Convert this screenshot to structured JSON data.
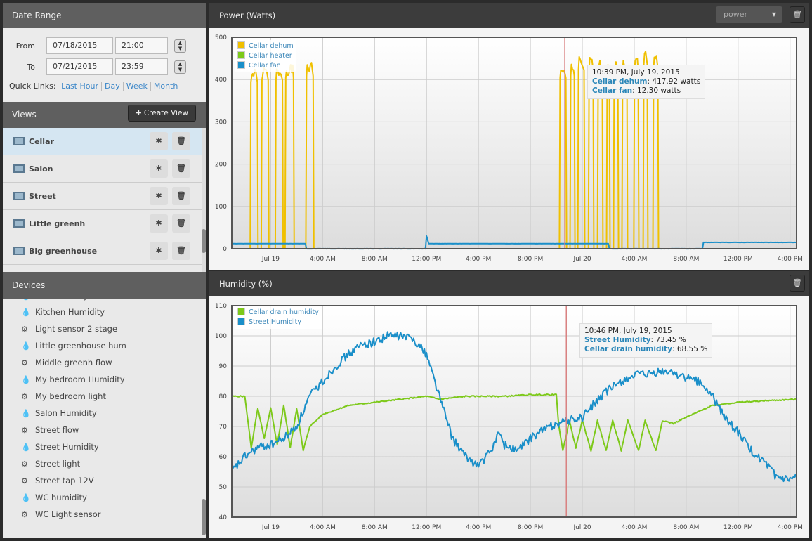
{
  "sidebar": {
    "date_range": {
      "title": "Date Range",
      "from_label": "From",
      "to_label": "To",
      "from_date": "07/18/2015",
      "from_time": "21:00",
      "to_date": "07/21/2015",
      "to_time": "23:59",
      "quick_links_label": "Quick Links:",
      "quick_links": [
        "Last Hour",
        "Day",
        "Week",
        "Month"
      ]
    },
    "views": {
      "title": "Views",
      "create_label": "Create View",
      "items": [
        {
          "label": "Cellar",
          "selected": true
        },
        {
          "label": "Salon"
        },
        {
          "label": "Street"
        },
        {
          "label": "Little greenh"
        },
        {
          "label": "Big greenhouse"
        }
      ]
    },
    "devices": {
      "title": "Devices",
      "partial_item": "WC Humidity",
      "items": [
        {
          "label": "Kitchen Humidity",
          "icon": "drop-icon"
        },
        {
          "label": "Light sensor 2 stage",
          "icon": "gear-icon"
        },
        {
          "label": "Little greenhouse hum",
          "icon": "drop-icon"
        },
        {
          "label": "Middle greenh flow",
          "icon": "gear-icon"
        },
        {
          "label": "My bedroom Humidity",
          "icon": "drop-icon"
        },
        {
          "label": "My bedroom light",
          "icon": "gear-icon"
        },
        {
          "label": "Salon Humidity",
          "icon": "drop-icon"
        },
        {
          "label": "Street flow",
          "icon": "gear-icon"
        },
        {
          "label": "Street Humidity",
          "icon": "drop-icon"
        },
        {
          "label": "Street light",
          "icon": "gear-icon"
        },
        {
          "label": "Street tap 12V",
          "icon": "gear-icon"
        },
        {
          "label": "WC humidity",
          "icon": "drop-icon"
        },
        {
          "label": "WC Light sensor",
          "icon": "gear-icon"
        }
      ]
    }
  },
  "panels": {
    "power": {
      "title": "Power (Watts)",
      "select_value": "power",
      "tooltip": {
        "time": "10:39 PM, July 19, 2015",
        "lines": [
          {
            "name": "Cellar dehum",
            "value": ": 417.92 watts"
          },
          {
            "name": "Cellar fan",
            "value": ": 12.30 watts"
          }
        ]
      }
    },
    "humidity": {
      "title": "Humidity (%)",
      "tooltip": {
        "time": "10:46 PM, July 19, 2015",
        "lines": [
          {
            "name": "Street Humidity",
            "value": ": 73.45 %"
          },
          {
            "name": "Cellar drain humidity",
            "value": ": 68.55 %"
          }
        ]
      }
    }
  },
  "chart_data": [
    {
      "type": "line",
      "xlim": [
        "2015-07-18T21:00",
        "2015-07-20T16:30"
      ],
      "ylim": [
        0,
        500
      ],
      "yticks": [
        0,
        100,
        200,
        300,
        400,
        500
      ],
      "xticks": [
        [
          "2015-07-19T00:00",
          "Jul 19"
        ],
        [
          "2015-07-19T04:00",
          "4:00 AM"
        ],
        [
          "2015-07-19T08:00",
          "8:00 AM"
        ],
        [
          "2015-07-19T12:00",
          "12:00 PM"
        ],
        [
          "2015-07-19T16:00",
          "4:00 PM"
        ],
        [
          "2015-07-19T20:00",
          "8:00 PM"
        ],
        [
          "2015-07-20T00:00",
          "Jul 20"
        ],
        [
          "2015-07-20T04:00",
          "4:00 AM"
        ],
        [
          "2015-07-20T08:00",
          "8:00 AM"
        ],
        [
          "2015-07-20T12:00",
          "12:00 PM"
        ],
        [
          "2015-07-20T16:00",
          "4:00 PM"
        ]
      ],
      "cursor": "2015-07-19T22:39",
      "legend": "top-left",
      "series": [
        {
          "name": "Cellar dehum",
          "color": "#f0c000",
          "on_intervals": [
            [
              "2015-07-18T22:25",
              "2015-07-18T22:58",
              415
            ],
            [
              "2015-07-18T23:16",
              "2015-07-18T23:48",
              420
            ],
            [
              "2015-07-19T00:21",
              "2015-07-19T00:54",
              420
            ],
            [
              "2015-07-19T01:06",
              "2015-07-19T01:45",
              425
            ],
            [
              "2015-07-19T02:42",
              "2015-07-19T03:16",
              430
            ],
            [
              "2015-07-19T22:14",
              "2015-07-19T22:44",
              425
            ],
            [
              "2015-07-19T23:03",
              "2015-07-19T23:23",
              430
            ],
            [
              "2015-07-19T23:39",
              "2015-07-20T00:08",
              445
            ],
            [
              "2015-07-20T00:28",
              "2015-07-20T00:50",
              445
            ],
            [
              "2015-07-20T01:10",
              "2015-07-20T01:32",
              440
            ],
            [
              "2015-07-20T01:52",
              "2015-07-20T02:05",
              440
            ],
            [
              "2015-07-20T02:24",
              "2015-07-20T02:44",
              435
            ],
            [
              "2015-07-20T03:03",
              "2015-07-20T03:26",
              440
            ],
            [
              "2015-07-20T03:58",
              "2015-07-20T04:18",
              445
            ],
            [
              "2015-07-20T04:41",
              "2015-07-20T05:00",
              460
            ],
            [
              "2015-07-20T05:26",
              "2015-07-20T05:49",
              450
            ]
          ]
        },
        {
          "name": "Cellar heater",
          "color": "#7dc91a",
          "on_intervals": []
        },
        {
          "name": "Cellar fan",
          "color": "#1a8fc9",
          "points": [
            [
              "2015-07-18T21:00",
              12
            ],
            [
              "2015-07-19T02:40",
              12
            ],
            [
              "2015-07-19T02:45",
              0
            ],
            [
              "2015-07-19T11:55",
              0
            ],
            [
              "2015-07-19T12:00",
              30
            ],
            [
              "2015-07-19T12:10",
              12
            ],
            [
              "2015-07-20T02:00",
              12
            ],
            [
              "2015-07-20T02:05",
              0
            ],
            [
              "2015-07-20T09:15",
              0
            ],
            [
              "2015-07-20T09:20",
              15
            ],
            [
              "2015-07-20T16:30",
              15
            ]
          ]
        }
      ]
    },
    {
      "type": "line",
      "xlim": [
        "2015-07-18T21:00",
        "2015-07-20T16:30"
      ],
      "ylim": [
        40,
        110
      ],
      "yticks": [
        40,
        50,
        60,
        70,
        80,
        90,
        100,
        110
      ],
      "xticks": [
        [
          "2015-07-19T00:00",
          "Jul 19"
        ],
        [
          "2015-07-19T04:00",
          "4:00 AM"
        ],
        [
          "2015-07-19T08:00",
          "8:00 AM"
        ],
        [
          "2015-07-19T12:00",
          "12:00 PM"
        ],
        [
          "2015-07-19T16:00",
          "4:00 PM"
        ],
        [
          "2015-07-19T20:00",
          "8:00 PM"
        ],
        [
          "2015-07-20T00:00",
          "Jul 20"
        ],
        [
          "2015-07-20T04:00",
          "4:00 AM"
        ],
        [
          "2015-07-20T08:00",
          "8:00 AM"
        ],
        [
          "2015-07-20T12:00",
          "12:00 PM"
        ],
        [
          "2015-07-20T16:00",
          "4:00 PM"
        ]
      ],
      "cursor": "2015-07-19T22:46",
      "legend": "top-left",
      "series": [
        {
          "name": "Cellar drain humidity",
          "color": "#7dc91a",
          "points": [
            [
              "2015-07-18T21:00",
              80
            ],
            [
              "2015-07-18T22:00",
              80
            ],
            [
              "2015-07-18T22:30",
              63
            ],
            [
              "2015-07-18T23:00",
              76
            ],
            [
              "2015-07-18T23:30",
              66
            ],
            [
              "2015-07-19T00:00",
              76
            ],
            [
              "2015-07-19T00:30",
              64
            ],
            [
              "2015-07-19T01:00",
              77
            ],
            [
              "2015-07-19T01:30",
              63
            ],
            [
              "2015-07-19T02:00",
              76
            ],
            [
              "2015-07-19T02:30",
              62
            ],
            [
              "2015-07-19T03:00",
              70
            ],
            [
              "2015-07-19T04:00",
              74
            ],
            [
              "2015-07-19T06:00",
              77
            ],
            [
              "2015-07-19T08:00",
              78
            ],
            [
              "2015-07-19T10:00",
              79
            ],
            [
              "2015-07-19T12:00",
              80
            ],
            [
              "2015-07-19T13:00",
              79
            ],
            [
              "2015-07-19T15:00",
              80
            ],
            [
              "2015-07-19T18:00",
              80
            ],
            [
              "2015-07-19T20:00",
              80.5
            ],
            [
              "2015-07-19T22:00",
              80.5
            ],
            [
              "2015-07-19T22:10",
              71
            ],
            [
              "2015-07-19T22:30",
              62
            ],
            [
              "2015-07-19T23:00",
              72
            ],
            [
              "2015-07-19T23:30",
              63
            ],
            [
              "2015-07-20T00:00",
              72
            ],
            [
              "2015-07-20T00:40",
              62
            ],
            [
              "2015-07-20T01:10",
              72
            ],
            [
              "2015-07-20T01:50",
              62
            ],
            [
              "2015-07-20T02:20",
              72
            ],
            [
              "2015-07-20T03:00",
              62
            ],
            [
              "2015-07-20T03:30",
              72
            ],
            [
              "2015-07-20T04:20",
              62
            ],
            [
              "2015-07-20T04:50",
              72
            ],
            [
              "2015-07-20T05:40",
              62
            ],
            [
              "2015-07-20T06:10",
              72
            ],
            [
              "2015-07-20T07:00",
              71
            ],
            [
              "2015-07-20T08:00",
              73
            ],
            [
              "2015-07-20T09:00",
              75
            ],
            [
              "2015-07-20T10:00",
              77
            ],
            [
              "2015-07-20T12:00",
              78
            ],
            [
              "2015-07-20T14:00",
              78.5
            ],
            [
              "2015-07-20T16:30",
              79
            ]
          ]
        },
        {
          "name": "Street Humidity",
          "color": "#1a8fc9",
          "points": [
            [
              "2015-07-18T21:00",
              55
            ],
            [
              "2015-07-18T22:00",
              60
            ],
            [
              "2015-07-18T23:00",
              63
            ],
            [
              "2015-07-19T00:00",
              64
            ],
            [
              "2015-07-19T01:00",
              66
            ],
            [
              "2015-07-19T02:00",
              70
            ],
            [
              "2015-07-19T03:00",
              80
            ],
            [
              "2015-07-19T04:00",
              85
            ],
            [
              "2015-07-19T05:00",
              90
            ],
            [
              "2015-07-19T06:00",
              94
            ],
            [
              "2015-07-19T07:00",
              97
            ],
            [
              "2015-07-19T08:00",
              98
            ],
            [
              "2015-07-19T09:00",
              100
            ],
            [
              "2015-07-19T10:00",
              100
            ],
            [
              "2015-07-19T11:00",
              99
            ],
            [
              "2015-07-19T12:00",
              94
            ],
            [
              "2015-07-19T13:00",
              80
            ],
            [
              "2015-07-19T14:00",
              66
            ],
            [
              "2015-07-19T15:00",
              60
            ],
            [
              "2015-07-19T16:00",
              57
            ],
            [
              "2015-07-19T17:00",
              62
            ],
            [
              "2015-07-19T17:30",
              68
            ],
            [
              "2015-07-19T18:00",
              64
            ],
            [
              "2015-07-19T19:00",
              62
            ],
            [
              "2015-07-19T20:00",
              66
            ],
            [
              "2015-07-19T21:00",
              69
            ],
            [
              "2015-07-19T22:00",
              71
            ],
            [
              "2015-07-19T23:00",
              72
            ],
            [
              "2015-07-20T00:00",
              73
            ],
            [
              "2015-07-20T01:00",
              78
            ],
            [
              "2015-07-20T02:00",
              82
            ],
            [
              "2015-07-20T03:00",
              85
            ],
            [
              "2015-07-20T04:00",
              87
            ],
            [
              "2015-07-20T05:00",
              87
            ],
            [
              "2015-07-20T06:00",
              88
            ],
            [
              "2015-07-20T07:00",
              88
            ],
            [
              "2015-07-20T08:00",
              86
            ],
            [
              "2015-07-20T09:00",
              85
            ],
            [
              "2015-07-20T10:00",
              80
            ],
            [
              "2015-07-20T11:00",
              73
            ],
            [
              "2015-07-20T12:00",
              68
            ],
            [
              "2015-07-20T13:00",
              62
            ],
            [
              "2015-07-20T14:00",
              58
            ],
            [
              "2015-07-20T15:00",
              53
            ],
            [
              "2015-07-20T16:00",
              52
            ],
            [
              "2015-07-20T16:30",
              53
            ]
          ]
        }
      ]
    }
  ]
}
